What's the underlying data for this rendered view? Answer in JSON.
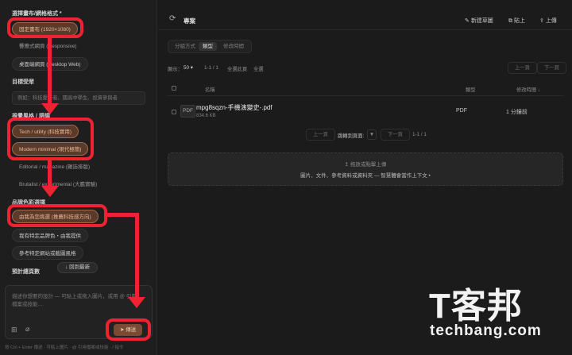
{
  "sidebar": {
    "section_canvas": "選擇畫布/網格格式 *",
    "canvas_options": [
      "固定畫布 (1920×1080)",
      "響應式網頁 (Responsive)",
      "桌面端網頁 (Desktop Web)"
    ],
    "section_audience": "目標受眾",
    "audience_placeholder": "例如：科技愛好者、國高中學生、投資參與者",
    "section_style": "視覺風格 / 語調",
    "style_options": [
      "Tech / utility (科技實用)",
      "Modern minimal (現代極簡)",
      "Editorial / magazine (雜誌排版)",
      "Brutalist / experimental (大膽實驗)"
    ],
    "section_color": "品牌色彩選擇",
    "color_options": [
      "由我為您挑選 (推薦科技感方向)",
      "我有特定品牌色・由我提供",
      "參考特定網站或截圖風格"
    ],
    "section_pages": "預計總頁數",
    "back_to_latest": "回到最新",
    "composer_placeholder": "描述你想要的設計 — 可貼上或拖入圖片，或用 @ 引用檔案或技能…",
    "send_label": "傳送",
    "footnote": "按 Ctrl + Enter 傳送 · 可貼上圖片 · @ 引用檔案或技能 · / 指令"
  },
  "main": {
    "title": "專案",
    "actions": {
      "new_sketch": "新建草圖",
      "paste": "貼上",
      "upload": "上傳"
    },
    "tabs": [
      "分組方式",
      "類型",
      "修改時間"
    ],
    "active_tab": 1,
    "display_label": "顯示：",
    "display_value": "50",
    "range_text": "1-1 / 1",
    "select_all_page": "全選此頁",
    "select_all": "全選",
    "prev_page": "上一頁",
    "next_page": "下一頁",
    "columns": {
      "name": "名稱",
      "type": "類型",
      "modified": "修改時間 ↓"
    },
    "files": [
      {
        "icon": "PDF",
        "name": "mpg8sqzn-手機演變史-.pdf",
        "size": "834.6 KB",
        "type": "PDF",
        "modified": "1 分鐘前"
      }
    ],
    "jump_label": "跳轉到頁面:",
    "page_info": "1-1 / 1",
    "drop_title": "拖放或點擊上傳",
    "drop_hint": "圖片、文件、參考資料或資料夾 — 智慧體會當作上下文 •"
  },
  "watermark": {
    "logo": "T客邦",
    "text": "techbang.com"
  },
  "colors": {
    "annotation": "#ee2230",
    "selected_chip": "#5a3a2a",
    "accent_text": "#e9b692"
  }
}
